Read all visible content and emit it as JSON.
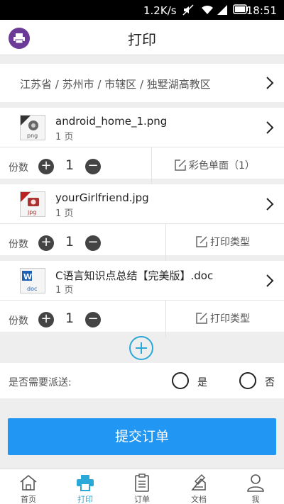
{
  "status_bar": {
    "speed": "1.2K/s",
    "time": "18:51"
  },
  "header": {
    "title": "打印"
  },
  "address": {
    "text": "江苏省 / 苏州市 / 市辖区 / 独墅湖高教区"
  },
  "files": [
    {
      "name": "android_home_1.png",
      "pages": "1 页",
      "file_type": "png",
      "copies_label": "份数",
      "quantity": "1",
      "print_type": "彩色单面（1）",
      "icon": "png-file-icon"
    },
    {
      "name": "yourGirlfriend.jpg",
      "pages": "1 页",
      "file_type": "jpg",
      "copies_label": "份数",
      "quantity": "1",
      "print_type": "打印类型",
      "icon": "jpg-file-icon"
    },
    {
      "name": "C语言知识点总结【完美版】.doc",
      "pages": "1 页",
      "file_type": "doc",
      "copies_label": "份数",
      "quantity": "1",
      "print_type": "打印类型",
      "icon": "word-file-icon"
    }
  ],
  "delivery": {
    "label": "是否需要派送:",
    "yes": "是",
    "no": "否"
  },
  "submit": {
    "label": "提交订单"
  },
  "tabs": [
    {
      "label": "首页",
      "icon": "home-icon"
    },
    {
      "label": "打印",
      "icon": "printer-icon",
      "active": true
    },
    {
      "label": "订单",
      "icon": "clipboard-icon"
    },
    {
      "label": "文档",
      "icon": "document-icon"
    },
    {
      "label": "我",
      "icon": "person-icon"
    }
  ],
  "colors": {
    "accent": "#2aa8d8",
    "submit": "#2196f3",
    "brand": "#6b3b97"
  }
}
